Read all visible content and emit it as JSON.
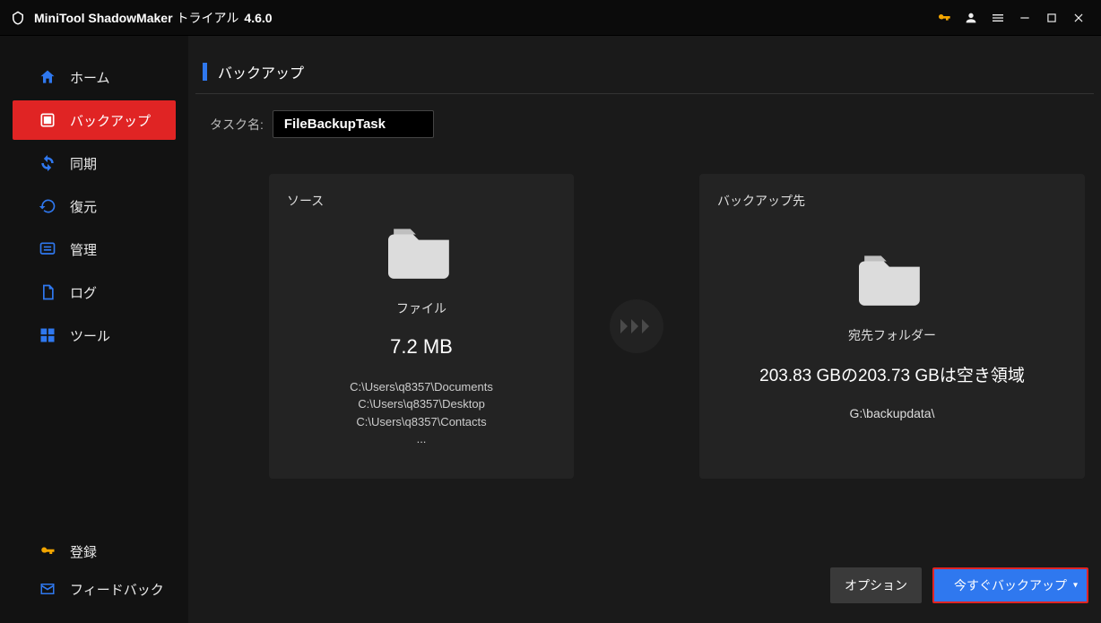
{
  "titlebar": {
    "app_name": "MiniTool ShadowMaker",
    "trial_text": "トライアル",
    "version": "4.6.0"
  },
  "sidebar": {
    "items": [
      {
        "label": "ホーム",
        "icon": "home"
      },
      {
        "label": "バックアップ",
        "icon": "backup"
      },
      {
        "label": "同期",
        "icon": "sync"
      },
      {
        "label": "復元",
        "icon": "restore"
      },
      {
        "label": "管理",
        "icon": "manage"
      },
      {
        "label": "ログ",
        "icon": "log"
      },
      {
        "label": "ツール",
        "icon": "tools"
      }
    ],
    "active_index": 1,
    "bottom": {
      "register": "登録",
      "feedback": "フィードバック"
    }
  },
  "page": {
    "title": "バックアップ",
    "task_label": "タスク名:",
    "task_value": "FileBackupTask"
  },
  "source_card": {
    "title": "ソース",
    "type_label": "ファイル",
    "size": "7.2 MB",
    "paths": [
      "C:\\Users\\q8357\\Documents",
      "C:\\Users\\q8357\\Desktop",
      "C:\\Users\\q8357\\Contacts",
      "..."
    ]
  },
  "dest_card": {
    "title": "バックアップ先",
    "type_label": "宛先フォルダー",
    "summary": "203.83 GBの203.73 GBは空き領域",
    "path": "G:\\backupdata\\"
  },
  "footer": {
    "options": "オプション",
    "backup_now": "今すぐバックアップ"
  }
}
